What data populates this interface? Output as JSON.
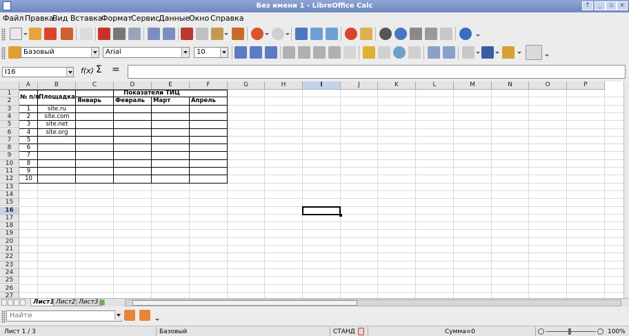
{
  "window": {
    "title": "Без имени 1 - LibreOffice Calc"
  },
  "menu": [
    "Файл",
    "Правка",
    "Вид",
    "Вставка",
    "Формат",
    "Сервис",
    "Данные",
    "Окно",
    "Справка"
  ],
  "format_toolbar": {
    "style": "Базовый",
    "font": "Arial",
    "size": "10"
  },
  "formula_bar": {
    "cell_ref": "I16",
    "function_wizard": "f(x)",
    "sum": "Σ",
    "equals": "=",
    "content": ""
  },
  "columns": [
    "A",
    "B",
    "C",
    "D",
    "E",
    "F",
    "G",
    "H",
    "I",
    "J",
    "K",
    "L",
    "M",
    "N",
    "O",
    "P"
  ],
  "rows": [
    "1",
    "2",
    "3",
    "4",
    "5",
    "6",
    "7",
    "8",
    "9",
    "10",
    "11",
    "12",
    "13",
    "14",
    "15",
    "16",
    "17",
    "18",
    "19",
    "20",
    "21",
    "22",
    "23",
    "24",
    "25",
    "26",
    "27"
  ],
  "selected": {
    "column": "I",
    "row": "16"
  },
  "sheet": {
    "header_num": "№ п/п",
    "header_site": "Площадка",
    "header_tic": "Показатели ТИЦ",
    "months": [
      "Январь",
      "Февраль",
      "Март",
      "Апрель"
    ],
    "numbers": [
      "1",
      "2",
      "3",
      "4",
      "5",
      "6",
      "7",
      "8",
      "9",
      "10"
    ],
    "sites": [
      "site.ru",
      "site.com",
      "site.net",
      "site.org"
    ]
  },
  "tabs": [
    "Лист1",
    "Лист2",
    "Лист3"
  ],
  "find": {
    "placeholder": "Найти"
  },
  "status": {
    "sheet": "Лист 1 / 3",
    "style": "Базовый",
    "mode": "СТАНД",
    "sum": "Сумма=0",
    "zoom": "100%"
  }
}
